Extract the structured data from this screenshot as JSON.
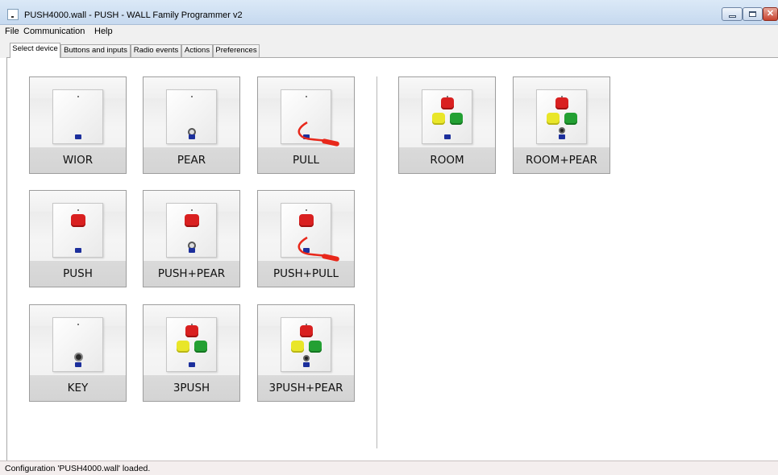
{
  "window": {
    "title": "PUSH4000.wall - PUSH - WALL Family Programmer v2",
    "icon": "app-icon",
    "controls": [
      "minimize-icon",
      "maximize-icon",
      "close-icon"
    ]
  },
  "menu": {
    "items": [
      "File",
      "Communication",
      "Help"
    ]
  },
  "tabs": {
    "items": [
      "Select device",
      "Buttons and inputs",
      "Radio events",
      "Actions",
      "Preferences"
    ],
    "active": "Select device"
  },
  "devices": {
    "left_group": [
      {
        "label": "WIOR",
        "image": "plain-plate"
      },
      {
        "label": "PEAR",
        "image": "plate-with-jack"
      },
      {
        "label": "PULL",
        "image": "plate-with-pull-cord"
      },
      {
        "label": "PUSH",
        "image": "plate-with-red-button"
      },
      {
        "label": "PUSH+PEAR",
        "image": "plate-with-red-button-and-jack"
      },
      {
        "label": "PUSH+PULL",
        "image": "plate-with-red-button-and-pull-cord"
      },
      {
        "label": "KEY",
        "image": "plate-with-keyhole"
      },
      {
        "label": "3PUSH",
        "image": "plate-with-three-buttons"
      },
      {
        "label": "3PUSH+PEAR",
        "image": "plate-with-three-buttons-and-jack"
      }
    ],
    "right_group": [
      {
        "label": "ROOM",
        "image": "plate-with-three-buttons"
      },
      {
        "label": "ROOM+PEAR",
        "image": "plate-with-three-buttons-and-jack"
      }
    ]
  },
  "colors": {
    "button_red": "#d92020",
    "button_yellow": "#e9e629",
    "button_green": "#23a033",
    "pull_cord": "#e8281b",
    "logo_blue": "#1c2f9c"
  },
  "status": {
    "text": "Configuration 'PUSH4000.wall' loaded."
  }
}
